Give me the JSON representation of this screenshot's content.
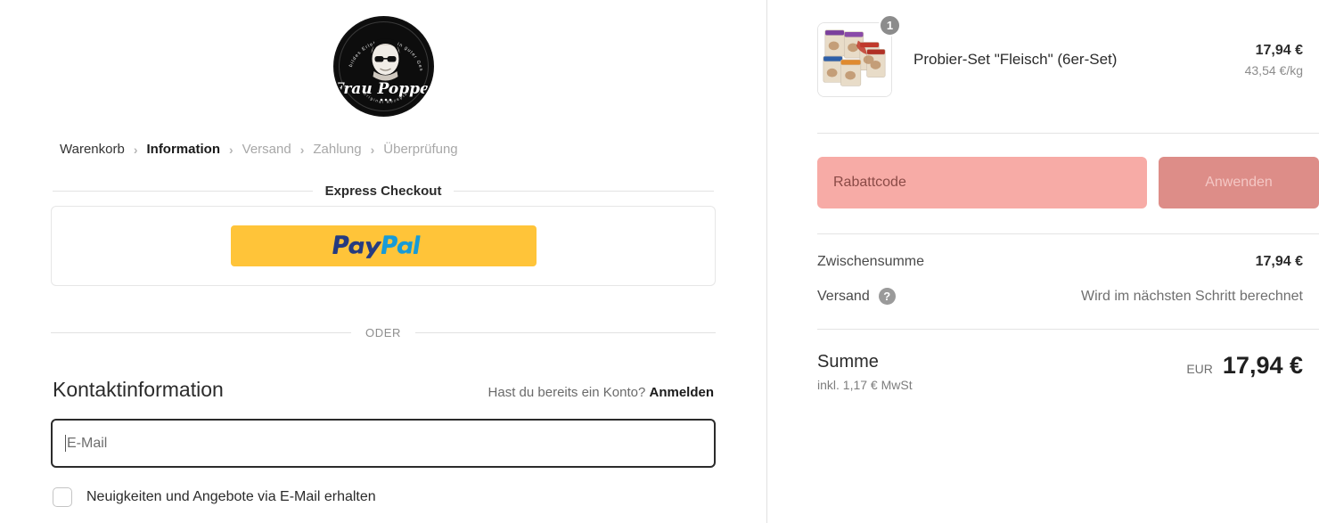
{
  "brand": {
    "logo_name": "Frau Poppes",
    "logo_script": "Frau Poppes",
    "logo_top_left": "bildes Erlebnis",
    "logo_top_right": "in guter Geschmack",
    "logo_bottom": "Original Rezeptur"
  },
  "breadcrumb": {
    "items": [
      {
        "label": "Warenkorb",
        "state": "done"
      },
      {
        "label": "Information",
        "state": "current"
      },
      {
        "label": "Versand",
        "state": "inactive"
      },
      {
        "label": "Zahlung",
        "state": "inactive"
      },
      {
        "label": "Überprüfung",
        "state": "inactive"
      }
    ],
    "separator": "›"
  },
  "express": {
    "title": "Express Checkout",
    "paypal_pay": "Pay",
    "paypal_pal": "Pal",
    "paypal_label": "PayPal"
  },
  "or_divider": {
    "label": "ODER"
  },
  "contact": {
    "title": "Kontaktinformation",
    "account_prompt": "Hast du bereits ein Konto?",
    "login_link": "Anmelden",
    "email_placeholder": "E-Mail",
    "email_value": "",
    "newsletter_label": "Neuigkeiten und Angebote via E-Mail erhalten",
    "newsletter_checked": false
  },
  "cart": {
    "item": {
      "name": "Probier-Set \"Fleisch\" (6er-Set)",
      "quantity": "1",
      "price": "17,94 €",
      "unit_price": "43,54 €/kg"
    },
    "discount": {
      "placeholder": "Rabattcode",
      "value": "",
      "apply_label": "Anwenden"
    },
    "summary": {
      "subtotal_label": "Zwischensumme",
      "subtotal_value": "17,94 €",
      "shipping_label": "Versand",
      "shipping_help_icon": "?",
      "shipping_value": "Wird im nächsten Schritt berechnet",
      "total_label": "Summe",
      "total_tax_note": "inkl. 1,17 € MwSt",
      "total_currency": "EUR",
      "total_value": "17,94 €"
    }
  },
  "colors": {
    "paypal_yellow": "#ffc439",
    "paypal_blue_dark": "#253b80",
    "paypal_blue_light": "#179bd7",
    "discount_field": "#f7aba6",
    "discount_button": "#dd8d88",
    "badge_gray": "#8c8c8c"
  }
}
